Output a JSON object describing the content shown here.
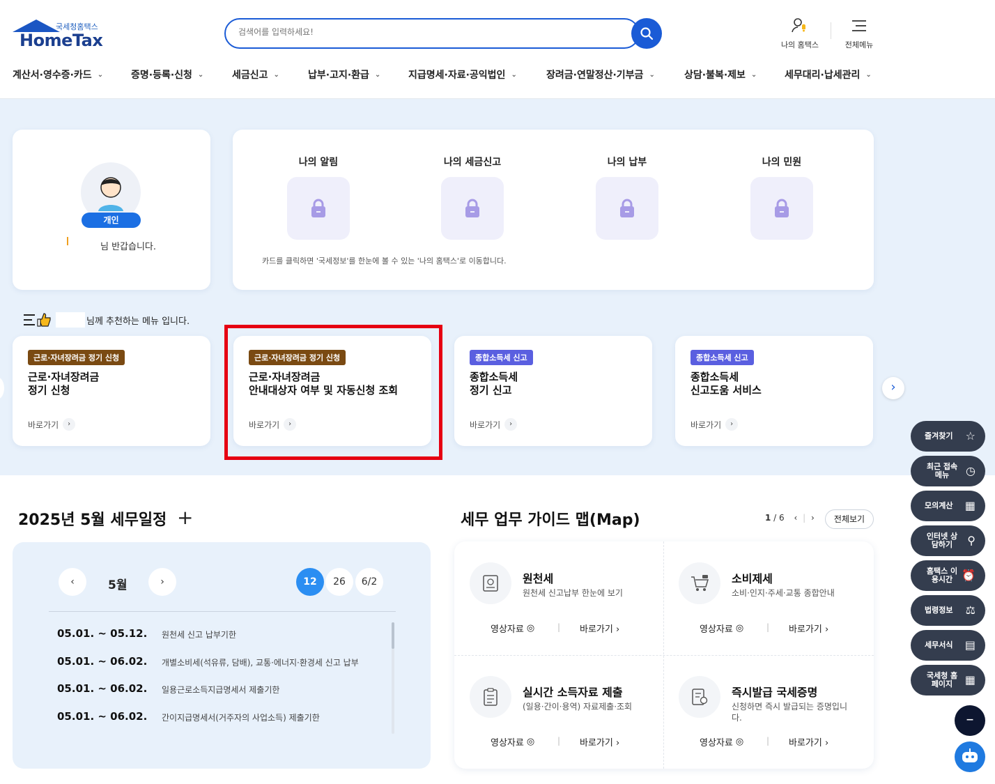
{
  "header": {
    "logo_sub": "국세청홈택스",
    "logo_main": "HomeTax",
    "search_placeholder": "검색어를 입력하세요!",
    "my_hometax": "나의 홈택스",
    "all_menu": "전체메뉴"
  },
  "gnb": [
    {
      "label": "계산서·영수증·카드"
    },
    {
      "label": "증명·등록·신청"
    },
    {
      "label": "세금신고"
    },
    {
      "label": "납부·고지·환급"
    },
    {
      "label": "지급명세·자료·공익법인"
    },
    {
      "label": "장려금·연말정산·기부금"
    },
    {
      "label": "상담·불복·제보"
    },
    {
      "label": "세무대리·납세관리"
    }
  ],
  "profile": {
    "badge": "개인",
    "greeting": "님 반갑습니다."
  },
  "my_tiles": [
    {
      "label": "나의 알림"
    },
    {
      "label": "나의 세금신고"
    },
    {
      "label": "나의 납부"
    },
    {
      "label": "나의 민원"
    }
  ],
  "my_note": "카드를 클릭하면 '국세정보'를 한눈에 볼 수 있는 '나의 홈택스'로 이동합니다.",
  "recommend_title": "님께 추천하는 메뉴 입니다.",
  "recommend": [
    {
      "tag": "근로·자녀장려금 정기 신청",
      "line1": "근로·자녀장려금",
      "line2": "정기 신청",
      "go": "바로가기",
      "tag_color": "#7a4a12"
    },
    {
      "tag": "근로·자녀장려금 정기 신청",
      "line1": "근로·자녀장려금",
      "line2": "안내대상자 여부 및 자동신청 조회",
      "go": "바로가기",
      "tag_color": "#7a4a12"
    },
    {
      "tag": "종합소득세 신고",
      "line1": "종합소득세",
      "line2": "정기 신고",
      "go": "바로가기",
      "tag_color": "#5a5fe0"
    },
    {
      "tag": "종합소득세 신고",
      "line1": "종합소득세",
      "line2": "신고도움 서비스",
      "go": "바로가기",
      "tag_color": "#5a5fe0"
    }
  ],
  "schedule": {
    "title": "2025년 5월 세무일정",
    "month": "5월",
    "dates": [
      "12",
      "26",
      "6/2"
    ],
    "rows": [
      {
        "date": "05.01. ~ 05.12.",
        "desc": "원천세 신고 납부기한"
      },
      {
        "date": "05.01. ~ 06.02.",
        "desc": "개별소비세(석유류, 담배), 교통·에너지·환경세 신고 납부"
      },
      {
        "date": "05.01. ~ 06.02.",
        "desc": "일용근로소득지급명세서 제출기한"
      },
      {
        "date": "05.01. ~ 06.02.",
        "desc": "간이지급명세서(거주자의 사업소득) 제출기한"
      }
    ]
  },
  "guide": {
    "title": "세무 업무 가이드 맵(Map)",
    "page_current": "1",
    "page_total": "6",
    "view_all": "전체보기",
    "video": "영상자료",
    "go": "바로가기",
    "items": [
      {
        "name": "원천세",
        "desc": "원천세 신고납부 한눈에 보기",
        "icon": "document-icon"
      },
      {
        "name": "소비제세",
        "desc": "소비·인지·주세·교통 종합안내",
        "icon": "cart-icon"
      },
      {
        "name": "실시간 소득자료 제출",
        "desc": "(일용·간이·용역) 자료제출·조회",
        "icon": "clipboard-icon"
      },
      {
        "name": "즉시발급 국세증명",
        "desc": "신청하면 즉시 발급되는 증명입니다.",
        "icon": "certificate-icon"
      }
    ]
  },
  "quick_menu": [
    {
      "label": "즐겨찾기",
      "icon": "star-icon"
    },
    {
      "label": "최근 접속메뉴",
      "icon": "clock-icon"
    },
    {
      "label": "모의계산",
      "icon": "calculator-icon"
    },
    {
      "label": "인터넷 상담하기",
      "icon": "chat-icon"
    },
    {
      "label": "홈택스 이용시간",
      "icon": "alarm-icon"
    },
    {
      "label": "법령정보",
      "icon": "gavel-icon"
    },
    {
      "label": "세무서식",
      "icon": "form-icon"
    },
    {
      "label": "국세청 홈페이지",
      "icon": "building-icon"
    }
  ],
  "colors": {
    "brand": "#1a5bd6",
    "band": "#e8f1fb",
    "highlight": "#e60012",
    "quick": "#343d4e"
  }
}
